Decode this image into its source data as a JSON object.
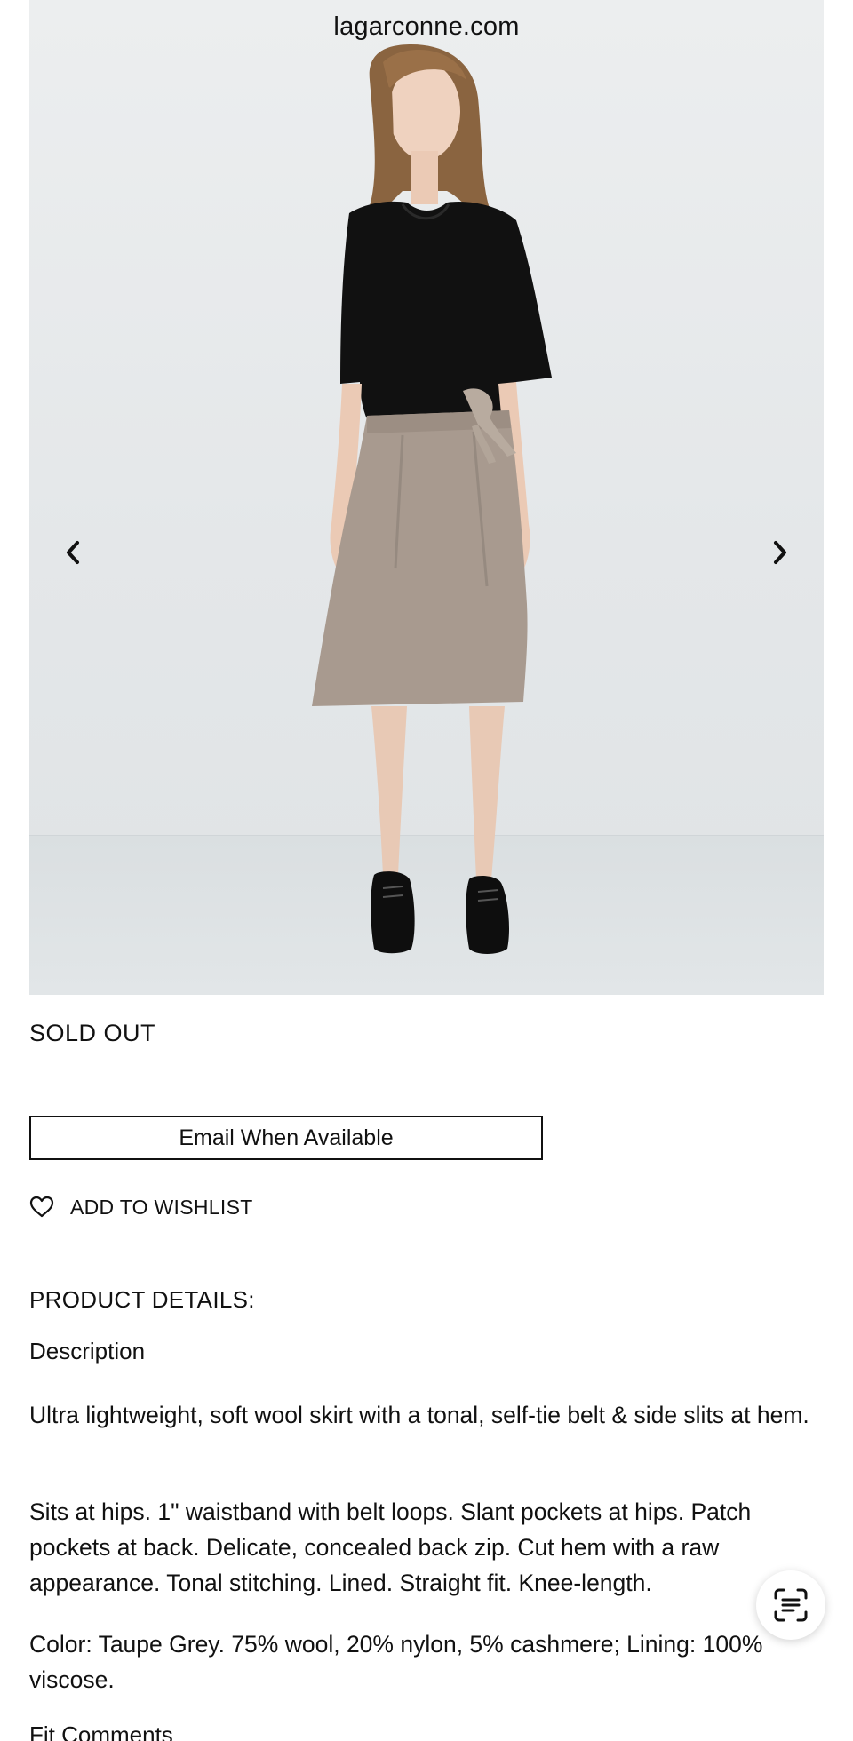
{
  "browser": {
    "domain": "lagarconne.com"
  },
  "product": {
    "status": "SOLD OUT",
    "email_button": "Email When Available",
    "wishlist_label": "ADD TO WISHLIST",
    "details_heading": "PRODUCT DETAILS:",
    "description_heading": "Description",
    "description_paragraphs": [
      "Ultra lightweight, soft wool skirt with a tonal, self-tie belt & side slits at hem.",
      "Sits at hips. 1\" waistband with belt loops. Slant pockets at hips. Patch pockets at back. Delicate, concealed back zip. Cut hem with a raw appearance. Tonal stitching. Lined. Straight fit. Knee-length.",
      "Color: Taupe Grey. 75% wool, 20% nylon, 5% cashmere; Lining: 100% viscose."
    ],
    "fit_heading": "Fit Comments"
  },
  "icons": {
    "prev": "chevron-left-icon",
    "next": "chevron-right-icon",
    "wishlist": "heart-icon",
    "scan": "text-scan-icon"
  }
}
